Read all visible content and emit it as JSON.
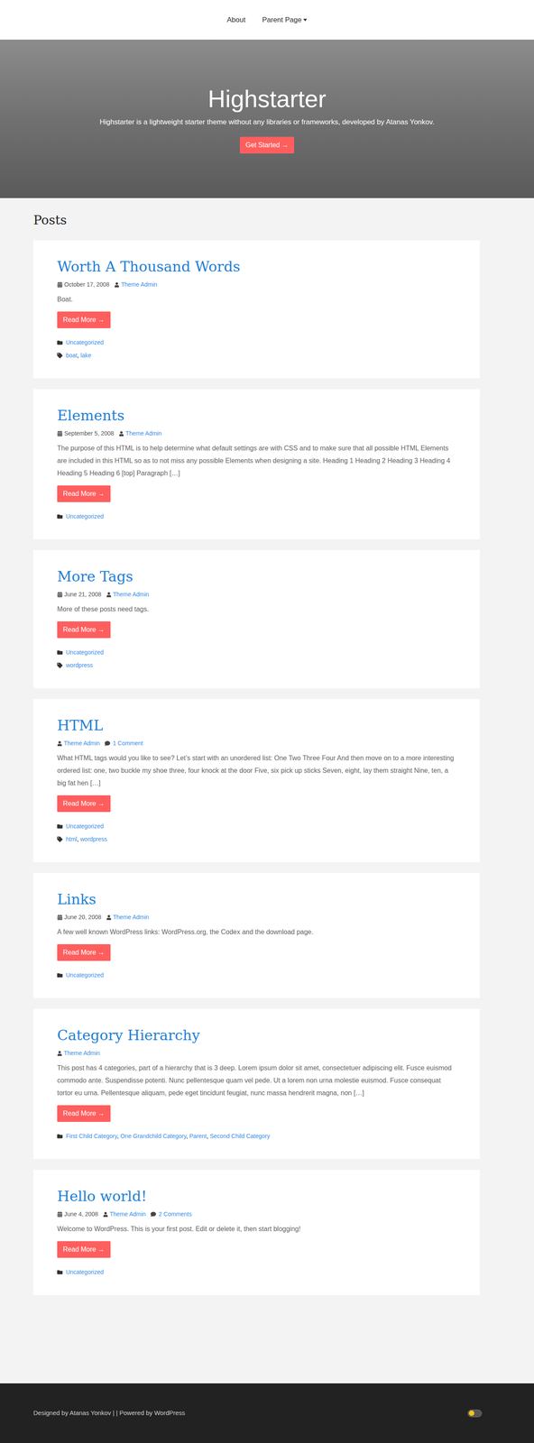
{
  "nav": {
    "items": [
      {
        "label": "About",
        "has_dropdown": false
      },
      {
        "label": "Parent Page",
        "has_dropdown": true
      }
    ]
  },
  "hero": {
    "title": "Highstarter",
    "subtitle": "Highstarter is a lightweight starter theme without any libraries or frameworks, developed by Atanas Yonkov.",
    "button": "Get Started →"
  },
  "section_title": "Posts",
  "read_more": "Read More →",
  "list_separator": ", ",
  "posts": [
    {
      "title": "Worth A Thousand Words",
      "date": "October 17, 2008",
      "author": "Theme Admin",
      "comments": "",
      "excerpt": "Boat.",
      "categories": [
        "Uncategorized"
      ],
      "tags": [
        "boat",
        "lake"
      ]
    },
    {
      "title": "Elements",
      "date": "September 5, 2008",
      "author": "Theme Admin",
      "comments": "",
      "excerpt": "The purpose of this HTML is to help determine what default settings are with CSS and to make sure that all possible HTML Elements are included in this HTML so as to not miss any possible Elements when designing a site. Heading 1 Heading 2 Heading 3 Heading 4 Heading 5 Heading 6 [top] Paragraph […]",
      "categories": [
        "Uncategorized"
      ],
      "tags": []
    },
    {
      "title": "More Tags",
      "date": "June 21, 2008",
      "author": "Theme Admin",
      "comments": "",
      "excerpt": "More of these posts need tags.",
      "categories": [
        "Uncategorized"
      ],
      "tags": [
        "wordpress"
      ]
    },
    {
      "title": "HTML",
      "date": "",
      "author": "Theme Admin",
      "comments": "1 Comment",
      "excerpt": "What HTML tags would you like to see? Let’s start with an unordered list: One Two Three Four And then move on to a more interesting ordered list: one, two buckle my shoe three, four knock at the door Five, six pick up sticks Seven, eight, lay them straight Nine, ten, a big fat hen […]",
      "categories": [
        "Uncategorized"
      ],
      "tags": [
        "html",
        "wordpress"
      ]
    },
    {
      "title": "Links",
      "date": "June 20, 2008",
      "author": "Theme Admin",
      "comments": "",
      "excerpt": "A few well known WordPress links: WordPress.org, the Codex and the download page.",
      "categories": [
        "Uncategorized"
      ],
      "tags": []
    },
    {
      "title": "Category Hierarchy",
      "date": "",
      "author": "Theme Admin",
      "comments": "",
      "excerpt": "This post has 4 categories, part of a hierarchy that is 3 deep. Lorem ipsum dolor sit amet, consectetuer adipiscing elit. Fusce euismod commodo ante. Suspendisse potenti. Nunc pellentesque quam vel pede. Ut a lorem non urna molestie euismod. Fusce consequat tortor eu urna. Pellentesque aliquam, pede eget tincidunt feugiat, nunc massa hendrerit magna, non […]",
      "categories": [
        "First Child Category",
        "One Grandchild Category",
        "Parent",
        "Second Child Category"
      ],
      "tags": []
    },
    {
      "title": "Hello world!",
      "date": "June 4, 2008",
      "author": "Theme Admin",
      "comments": "2 Comments",
      "excerpt": "Welcome to WordPress. This is your first post. Edit or delete it, then start blogging!",
      "categories": [
        "Uncategorized"
      ],
      "tags": []
    }
  ],
  "footer": {
    "text": "Designed by Atanas Yonkov | | Powered by WordPress",
    "theme_toggle": {
      "on": false
    }
  }
}
